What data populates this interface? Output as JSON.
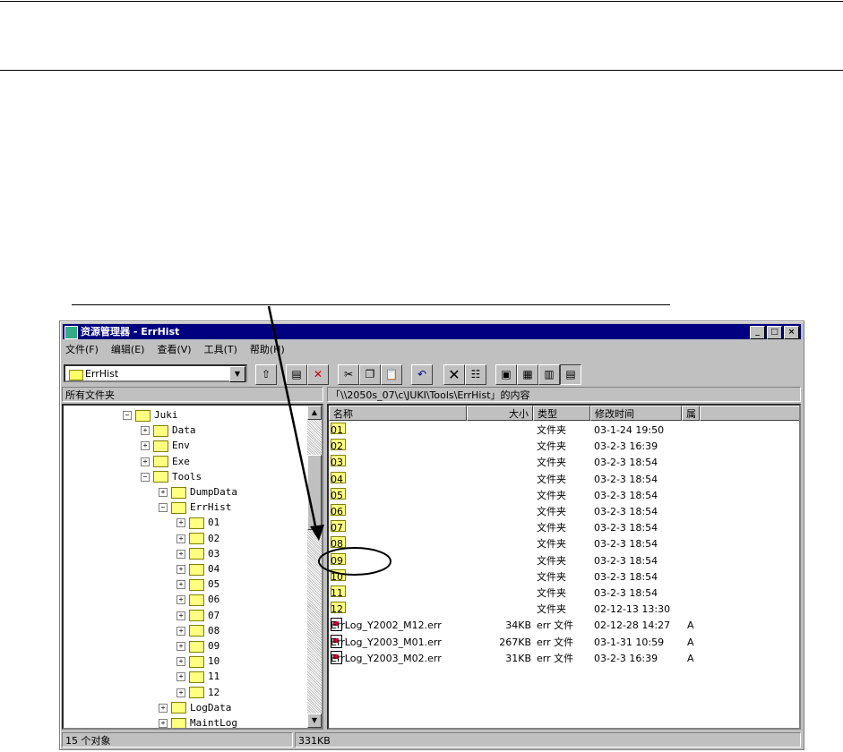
{
  "window": {
    "title": "资源管理器 - ErrHist",
    "controls": [
      "_",
      "□",
      "×"
    ]
  },
  "menu": [
    "文件(F)",
    "编辑(E)",
    "查看(V)",
    "工具(T)",
    "帮助(H)"
  ],
  "address": {
    "value": "ErrHist"
  },
  "toolbar": [
    "up-folder",
    "map-drive",
    "disconnect-drive",
    "cut",
    "copy",
    "paste",
    "undo",
    "delete",
    "properties",
    "large-icons",
    "small-icons",
    "list",
    "details"
  ],
  "tree": {
    "header": "所有文件夹",
    "items": [
      {
        "label": "Juki",
        "level": 0,
        "sign": "-"
      },
      {
        "label": "Data",
        "level": 1,
        "sign": "+"
      },
      {
        "label": "Env",
        "level": 1,
        "sign": "+"
      },
      {
        "label": "Exe",
        "level": 1,
        "sign": "+"
      },
      {
        "label": "Tools",
        "level": 1,
        "sign": "-"
      },
      {
        "label": "DumpData",
        "level": 2,
        "sign": "+"
      },
      {
        "label": "ErrHist",
        "level": 2,
        "sign": "-"
      },
      {
        "label": "01",
        "level": 3,
        "sign": "+"
      },
      {
        "label": "02",
        "level": 3,
        "sign": "+"
      },
      {
        "label": "03",
        "level": 3,
        "sign": "+"
      },
      {
        "label": "04",
        "level": 3,
        "sign": "+"
      },
      {
        "label": "05",
        "level": 3,
        "sign": "+"
      },
      {
        "label": "06",
        "level": 3,
        "sign": "+"
      },
      {
        "label": "07",
        "level": 3,
        "sign": "+"
      },
      {
        "label": "08",
        "level": 3,
        "sign": "+"
      },
      {
        "label": "09",
        "level": 3,
        "sign": "+"
      },
      {
        "label": "10",
        "level": 3,
        "sign": "+"
      },
      {
        "label": "11",
        "level": 3,
        "sign": "+"
      },
      {
        "label": "12",
        "level": 3,
        "sign": "+"
      },
      {
        "label": "LogData",
        "level": 2,
        "sign": "+"
      },
      {
        "label": "MaintLog",
        "level": 2,
        "sign": "+"
      }
    ]
  },
  "list": {
    "header": "「\\\\2050s_07\\c\\JUKI\\Tools\\ErrHist」的内容",
    "columns": [
      "名称",
      "大小",
      "类型",
      "修改时间",
      "属"
    ],
    "rows": [
      {
        "name": "01",
        "size": "",
        "type": "文件夹",
        "modified": "03-1-24 19:50",
        "attr": "",
        "kind": "folder"
      },
      {
        "name": "02",
        "size": "",
        "type": "文件夹",
        "modified": "03-2-3 16:39",
        "attr": "",
        "kind": "folder"
      },
      {
        "name": "03",
        "size": "",
        "type": "文件夹",
        "modified": "03-2-3 18:54",
        "attr": "",
        "kind": "folder"
      },
      {
        "name": "04",
        "size": "",
        "type": "文件夹",
        "modified": "03-2-3 18:54",
        "attr": "",
        "kind": "folder"
      },
      {
        "name": "05",
        "size": "",
        "type": "文件夹",
        "modified": "03-2-3 18:54",
        "attr": "",
        "kind": "folder"
      },
      {
        "name": "06",
        "size": "",
        "type": "文件夹",
        "modified": "03-2-3 18:54",
        "attr": "",
        "kind": "folder"
      },
      {
        "name": "07",
        "size": "",
        "type": "文件夹",
        "modified": "03-2-3 18:54",
        "attr": "",
        "kind": "folder"
      },
      {
        "name": "08",
        "size": "",
        "type": "文件夹",
        "modified": "03-2-3 18:54",
        "attr": "",
        "kind": "folder"
      },
      {
        "name": "09",
        "size": "",
        "type": "文件夹",
        "modified": "03-2-3 18:54",
        "attr": "",
        "kind": "folder"
      },
      {
        "name": "10",
        "size": "",
        "type": "文件夹",
        "modified": "03-2-3 18:54",
        "attr": "",
        "kind": "folder"
      },
      {
        "name": "11",
        "size": "",
        "type": "文件夹",
        "modified": "03-2-3 18:54",
        "attr": "",
        "kind": "folder"
      },
      {
        "name": "12",
        "size": "",
        "type": "文件夹",
        "modified": "02-12-13 13:30",
        "attr": "",
        "kind": "folder"
      },
      {
        "name": "ErrLog_Y2002_M12.err",
        "size": "34KB",
        "type": "err 文件",
        "modified": "02-12-28 14:27",
        "attr": "A",
        "kind": "file"
      },
      {
        "name": "ErrLog_Y2003_M01.err",
        "size": "267KB",
        "type": "err 文件",
        "modified": "03-1-31 10:59",
        "attr": "A",
        "kind": "file"
      },
      {
        "name": "ErrLog_Y2003_M02.err",
        "size": "31KB",
        "type": "err 文件",
        "modified": "03-2-3 16:39",
        "attr": "A",
        "kind": "file"
      }
    ]
  },
  "status": {
    "count": "15 个对象",
    "size": "331KB"
  }
}
